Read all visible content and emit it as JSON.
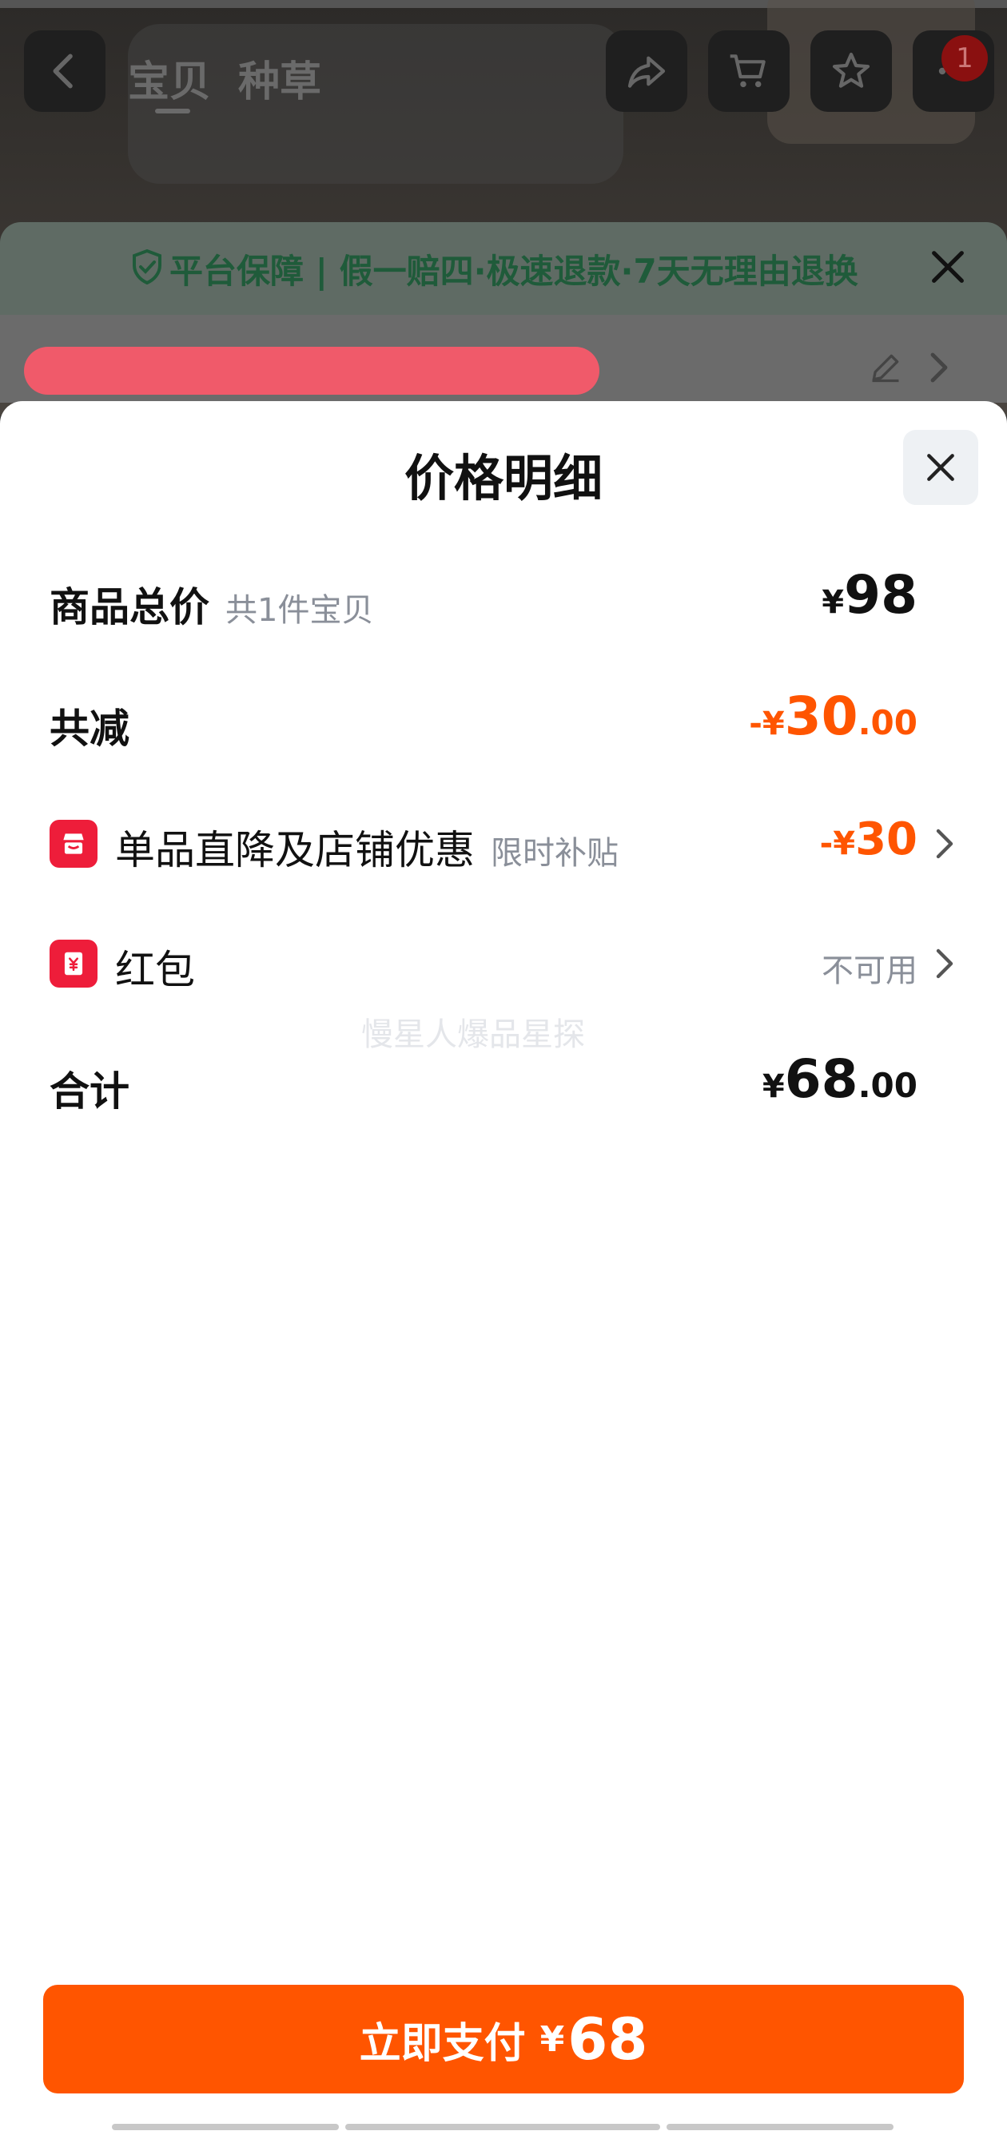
{
  "nav": {
    "tabs": [
      "宝贝",
      "种草"
    ],
    "badge_count": "1",
    "icons": [
      "back-arrow-icon",
      "share-icon",
      "cart-icon",
      "star-icon",
      "more-icon"
    ]
  },
  "guarantee": {
    "text": "平台保障 | 假一赔四·极速退款·7天无理由退换",
    "color": "#1f5b3a"
  },
  "sheet": {
    "title": "价格明细",
    "rows": {
      "total": {
        "label": "商品总价",
        "sub": "共1件宝贝",
        "yen": "¥",
        "int": "98",
        "dec": ""
      },
      "reduce": {
        "label": "共减",
        "yen": "-¥",
        "int": "30",
        "dec": ".00"
      },
      "discount": {
        "label": "单品直降及店铺优惠",
        "sub": "限时补贴",
        "yen": "-¥",
        "int": "30",
        "icon": "store-icon"
      },
      "redpacket": {
        "label": "红包",
        "status": "不可用",
        "icon": "red-packet-icon"
      },
      "sum": {
        "label": "合计",
        "yen": "¥",
        "int": "68",
        "dec": ".00"
      }
    },
    "watermark": "慢星人爆品星探",
    "pay": {
      "label": "立即支付",
      "yen": "¥",
      "amount": "68"
    }
  },
  "colors": {
    "accent": "#ff5500",
    "icon_red": "#ee1d3a",
    "muted": "#8a8f99"
  }
}
